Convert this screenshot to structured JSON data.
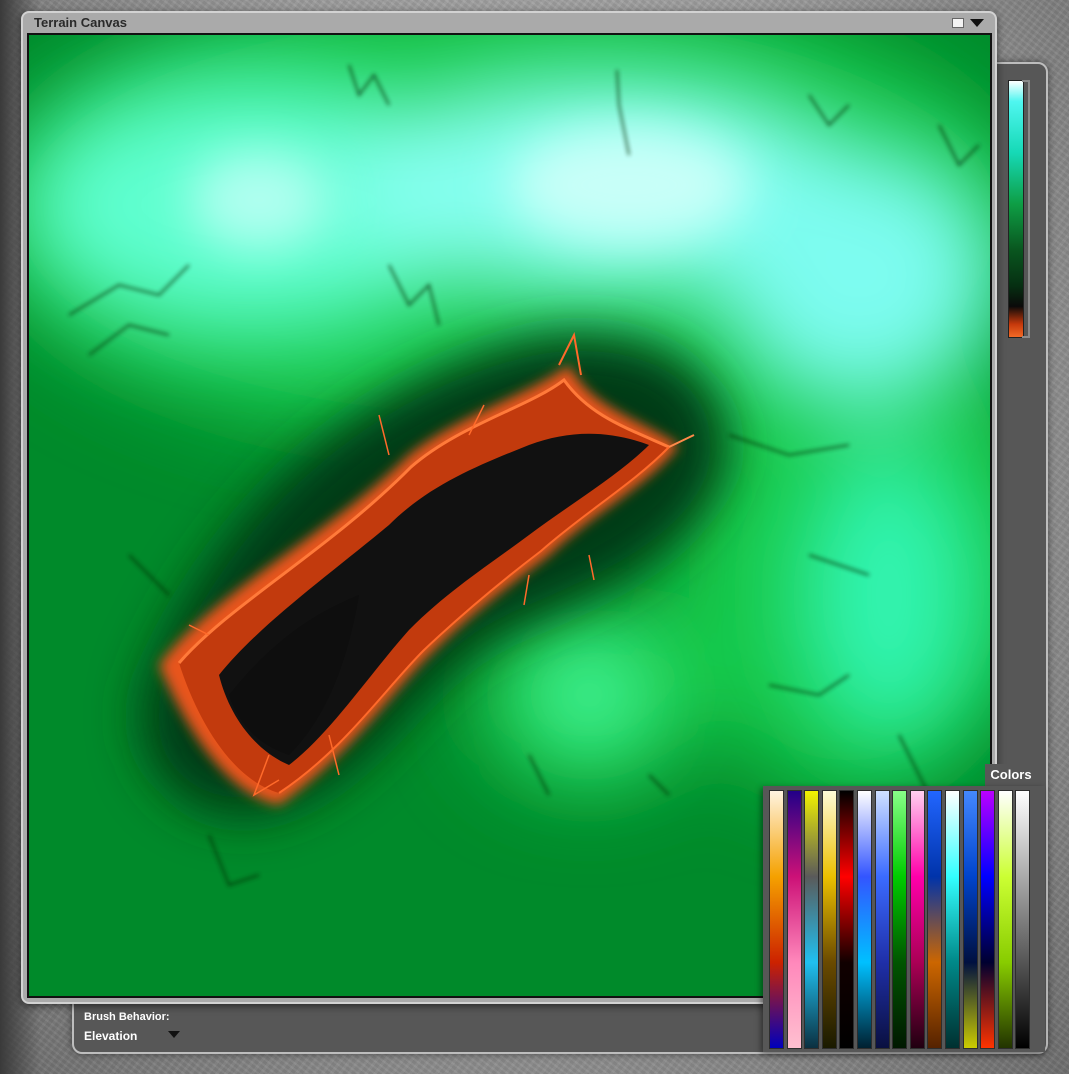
{
  "window": {
    "title": "Terrain Canvas",
    "icons": [
      "window-mode-icon",
      "panel-menu-arrow-icon"
    ]
  },
  "side_panel": {
    "brush_behavior_label": "Brush Behavior:",
    "brush_behavior_value": "Elevation"
  },
  "colors": {
    "tab_label": "Colors",
    "swatches": [
      {
        "name": "warm-white-orange-red-blue",
        "stops": [
          "#fff4e0",
          "#f5a100",
          "#cc2200",
          "#0000bb"
        ]
      },
      {
        "name": "purple-magenta-pink",
        "stops": [
          "#220088",
          "#cc1177",
          "#ff88bb",
          "#ffc0d0"
        ]
      },
      {
        "name": "yellow-gray-cyan",
        "stops": [
          "#f2f200",
          "#5a5a5a",
          "#20c0f0",
          "#0b3040"
        ]
      },
      {
        "name": "cream-gold-black",
        "stops": [
          "#fffbd8",
          "#ecc000",
          "#6a4a00",
          "#1a1a00"
        ]
      },
      {
        "name": "black-red-black",
        "stops": [
          "#000000",
          "#ff0000",
          "#110000",
          "#000000"
        ]
      },
      {
        "name": "white-blue-cyan",
        "stops": [
          "#ffffff",
          "#3355ff",
          "#00c0ff",
          "#002030"
        ]
      },
      {
        "name": "blue-striped",
        "stops": [
          "#cfe0ff",
          "#3b6bff",
          "#1f2fa8",
          "#0a1040"
        ]
      },
      {
        "name": "green-black",
        "stops": [
          "#88ff88",
          "#00cc00",
          "#005500",
          "#001800"
        ]
      },
      {
        "name": "magenta-pink",
        "stops": [
          "#ffd0f0",
          "#ff00aa",
          "#aa0055",
          "#200010"
        ]
      },
      {
        "name": "blue-orange-dashed",
        "stops": [
          "#2266ff",
          "#0033aa",
          "#cc6600",
          "#552200"
        ]
      },
      {
        "name": "white-cyan-teal",
        "stops": [
          "#ffffff",
          "#33ffff",
          "#008888",
          "#003030"
        ]
      },
      {
        "name": "blue-yellow",
        "stops": [
          "#4488ff",
          "#0044cc",
          "#001040",
          "#cccc00"
        ]
      },
      {
        "name": "violet-blue-red",
        "stops": [
          "#bb00ff",
          "#0000ff",
          "#000030",
          "#ff3300"
        ]
      },
      {
        "name": "white-lime-green",
        "stops": [
          "#ffffff",
          "#ccff33",
          "#88cc00",
          "#223300"
        ]
      },
      {
        "name": "white-gray-black",
        "stops": [
          "#ffffff",
          "#aaaaaa",
          "#555555",
          "#000000"
        ]
      }
    ]
  }
}
